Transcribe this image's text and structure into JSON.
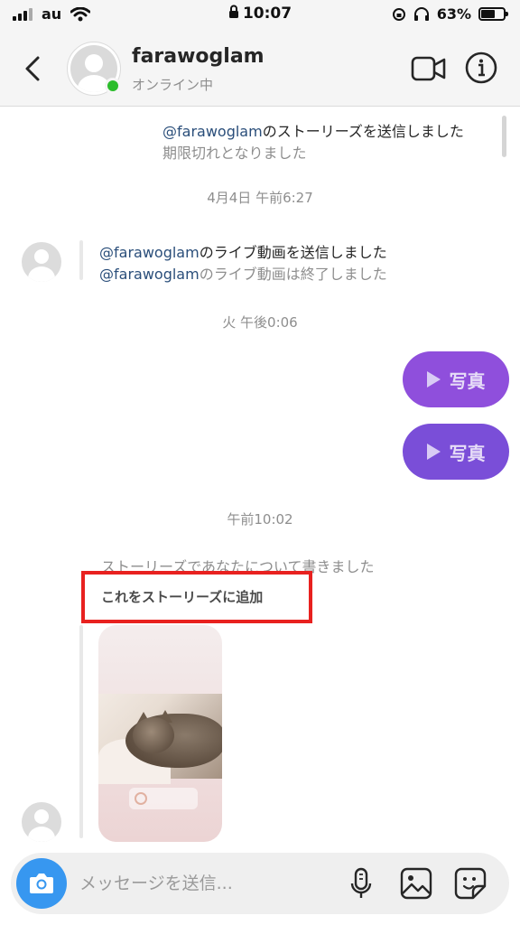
{
  "status_bar": {
    "carrier": "au",
    "time": "10:07",
    "battery": "63%",
    "battery_level": 0.63
  },
  "header": {
    "username": "farawoglam",
    "status": "オンライン中",
    "online_color": "#2cbd2c"
  },
  "messages": {
    "story_share": {
      "mention": "@farawoglam",
      "text": "のストーリーズを送信しました",
      "expired": "期限切れとなりました"
    },
    "ts1": "4月4日 午前6:27",
    "live": {
      "mention1": "@farawoglam",
      "text1": "のライブ動画を送信しました",
      "mention2": "@farawoglam",
      "text2": "のライブ動画は終了しました"
    },
    "ts2": "火 午後0:06",
    "photo_label": "写真",
    "photo_bubbles": [
      {
        "label": "写真",
        "color": "#8f4fdc"
      },
      {
        "label": "写真",
        "color": "#7a4ed8"
      }
    ],
    "ts3": "午前10:02",
    "mention_story": "ストーリーズであなたについて書きました",
    "add_to_story": "これをストーリーズに追加",
    "highlight_color": "#e8211f"
  },
  "composer": {
    "placeholder": "メッセージを送信...",
    "accent": "#3797f0"
  },
  "icons": [
    "back-chevron-icon",
    "video-call-icon",
    "info-icon",
    "camera-icon",
    "microphone-icon",
    "gallery-icon",
    "sticker-icon"
  ]
}
